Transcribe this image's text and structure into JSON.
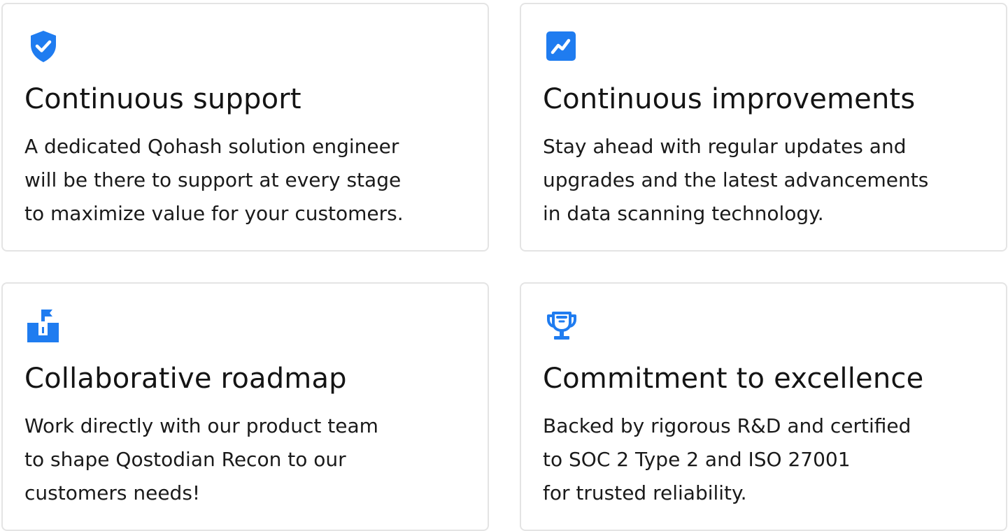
{
  "colors": {
    "accent": "#1f7cf0",
    "card_border": "#e4e4e4",
    "text": "#141414"
  },
  "cards": [
    {
      "icon": "shield-check-icon",
      "title": "Continuous support",
      "lines": [
        "A dedicated Qohash solution engineer",
        "will be there to support at every stage",
        "to maximize value for your customers."
      ]
    },
    {
      "icon": "trend-chart-icon",
      "title": "Continuous improvements",
      "lines": [
        "Stay ahead with regular updates and",
        "upgrades and the latest advancements",
        "in data scanning technology."
      ]
    },
    {
      "icon": "roadmap-flag-icon",
      "title": "Collaborative roadmap",
      "lines": [
        "Work directly with our product team",
        "to shape Qostodian Recon to our",
        "customers needs!"
      ]
    },
    {
      "icon": "trophy-icon",
      "title": "Commitment to excellence",
      "lines": [
        "Backed by rigorous R&D and certified",
        "to SOC 2 Type 2 and ISO 27001",
        "for trusted reliability."
      ]
    }
  ]
}
